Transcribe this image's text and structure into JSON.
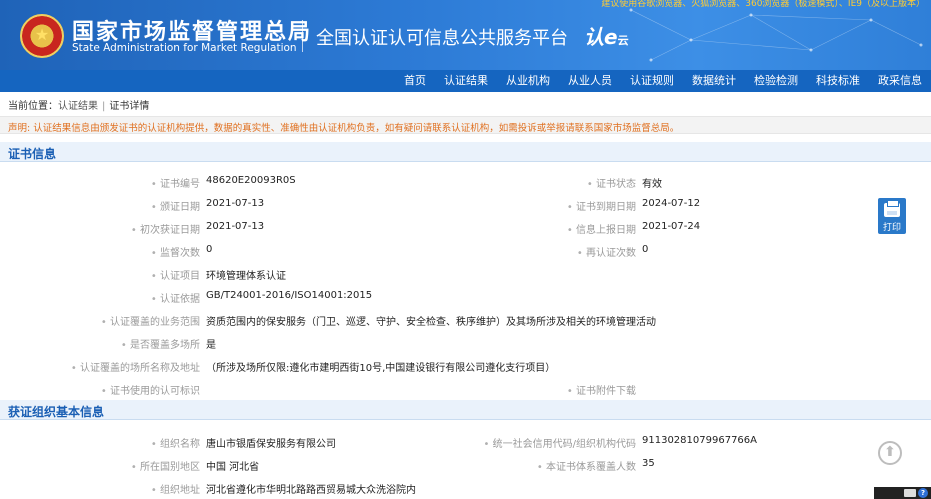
{
  "header": {
    "top_notice": "建议使用谷歌浏览器、火狐浏览器、360浏览器（极速模式）、IE9（及以上版本）",
    "org_name_cn": "国家市场监督管理总局",
    "org_name_en": "State Administration  for  Market Regulation",
    "platform_name": "全国认证认可信息公共服务平台",
    "cloud_logo": "认e",
    "cloud_logo_small": "云"
  },
  "nav": {
    "items": [
      "首页",
      "认证结果",
      "从业机构",
      "从业人员",
      "认证规则",
      "数据统计",
      "检验检测",
      "科技标准",
      "政采信息"
    ]
  },
  "breadcrumb": {
    "prefix": "当前位置：",
    "crumb1": "认证结果",
    "crumb2": "证书详情"
  },
  "notice": "声明: 认证结果信息由颁发证书的认证机构提供，数据的真实性、准确性由认证机构负责，如有疑问请联系认证机构，如需投诉或举报请联系国家市场监督总局。",
  "certificate": {
    "title": "证书信息",
    "cert_no_label": "证书编号",
    "cert_no": "48620E20093R0S",
    "status_label": "证书状态",
    "status": "有效",
    "issue_date_label": "颁证日期",
    "issue_date": "2021-07-13",
    "expire_date_label": "证书到期日期",
    "expire_date": "2024-07-12",
    "first_date_label": "初次获证日期",
    "first_date": "2021-07-13",
    "report_date_label": "信息上报日期",
    "report_date": "2021-07-24",
    "supervision_label": "监督次数",
    "supervision": "0",
    "recert_label": "再认证次数",
    "recert": "0",
    "project_label": "认证项目",
    "project": "环境管理体系认证",
    "basis_label": "认证依据",
    "basis": "GB/T24001-2016/ISO14001:2015",
    "scope_label": "认证覆盖的业务范围",
    "scope": "资质范围内的保安服务（门卫、巡逻、守护、安全检查、秩序维护）及其场所涉及相关的环境管理活动",
    "multi_site_label": "是否覆盖多场所",
    "multi_site": "是",
    "site_address_label": "认证覆盖的场所名称及地址",
    "site_address": "（所涉及场所仅限:遵化市建明西街10号,中国建设银行有限公司遵化支行项目）",
    "mark_label": "证书使用的认可标识",
    "attachment_label": "证书附件下载",
    "print_label": "打印"
  },
  "organization": {
    "title": "获证组织基本信息",
    "name_label": "组织名称",
    "name": "唐山市银盾保安服务有限公司",
    "credit_code_label": "统一社会信用代码/组织机构代码",
    "credit_code": "91130281079967766A",
    "region_label": "所在国别地区",
    "region": "中国 河北省",
    "headcount_label": "本证书体系覆盖人数",
    "headcount": "35",
    "address_label": "组织地址",
    "address": "河北省遵化市华明北路路西贸易城大众洗浴院内"
  },
  "ui": {
    "back_top_glyph": "⬆",
    "help_glyph": "?"
  }
}
